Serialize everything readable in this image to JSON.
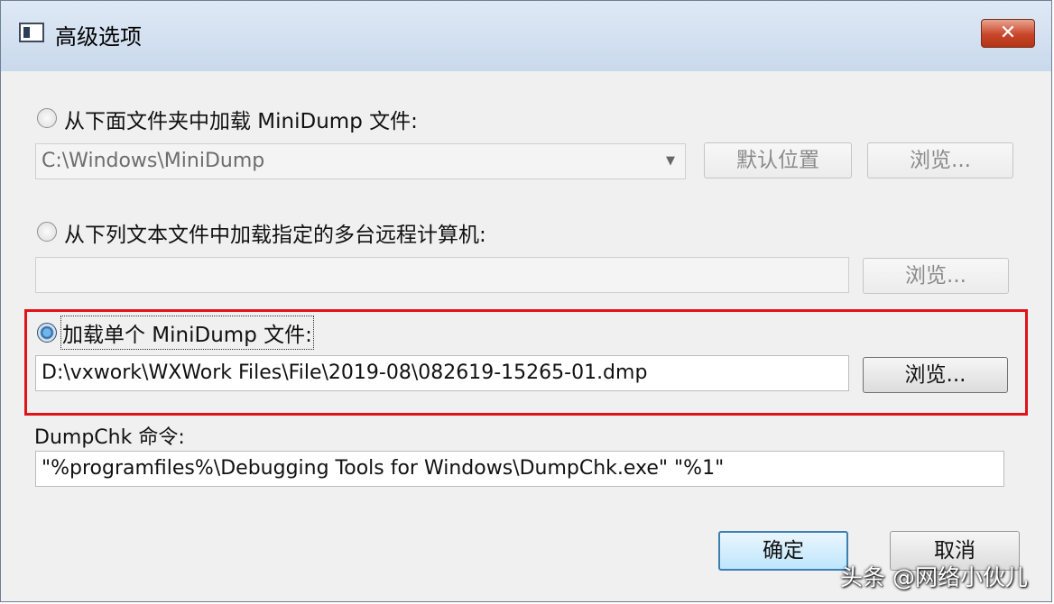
{
  "window": {
    "title": "高级选项",
    "close_label": "✕"
  },
  "option_folder": {
    "label": "从下面文件夹中加载 MiniDump 文件:",
    "path_value": "C:\\Windows\\MiniDump",
    "default_location_label": "默认位置",
    "browse_label": "浏览...",
    "selected": false
  },
  "option_remote": {
    "label": "从下列文本文件中加载指定的多台远程计算机:",
    "path_value": "",
    "browse_label": "浏览...",
    "selected": false
  },
  "option_single": {
    "label": "加载单个 MiniDump 文件:",
    "path_value": "D:\\vxwork\\WXWork Files\\File\\2019-08\\082619-15265-01.dmp",
    "browse_label": "浏览...",
    "selected": true
  },
  "dumpchk": {
    "label": "DumpChk 命令:",
    "command_value": "\"%programfiles%\\Debugging Tools for Windows\\DumpChk.exe\" \"%1\""
  },
  "footer": {
    "ok_label": "确定",
    "cancel_label": "取消"
  },
  "watermark": "头条 @网络小伙儿",
  "colors": {
    "highlight_border": "#e0131a",
    "close_button": "#c8452a"
  }
}
